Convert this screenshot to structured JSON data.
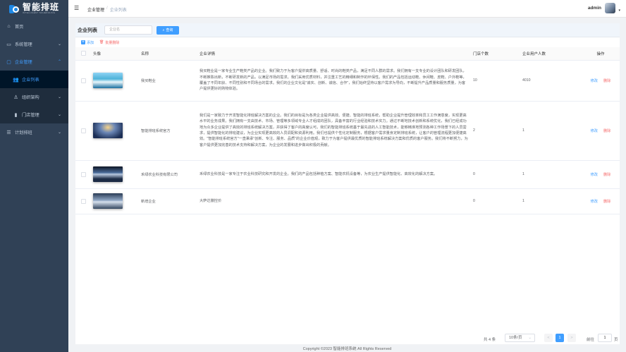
{
  "logo": {
    "title": "智能排班",
    "subtitle": "INTELLIGENT SCHEDULING"
  },
  "sidebar": {
    "items": [
      {
        "label": "首页",
        "icon": "home-icon"
      },
      {
        "label": "系统管理",
        "icon": "monitor-icon"
      },
      {
        "label": "企业管理",
        "icon": "chat-icon"
      },
      {
        "label": "企业列表",
        "icon": "users-icon"
      },
      {
        "label": "组织架构",
        "icon": "org-icon"
      },
      {
        "label": "门店管理",
        "icon": "store-icon"
      },
      {
        "label": "计划排班",
        "icon": "list-icon"
      }
    ]
  },
  "header": {
    "breadcrumb": [
      "企业管理",
      "企业列表"
    ],
    "separator": "/",
    "user": "admin"
  },
  "panel": {
    "title": "企业列表",
    "search_placeholder": "企业名",
    "search_button": "查询",
    "add_label": "添加",
    "batch_delete_label": "批量删除"
  },
  "table": {
    "headers": [
      "头像",
      "名称",
      "企业详情",
      "门店个数",
      "企业用户人数",
      "操作"
    ],
    "rows": [
      {
        "name": "我买鞋业",
        "detail": "我买鞋业是一家专业生产鞋类产品的企业。我们致力于为客户提供高质量、舒适、时尚的鞋类产品，满足不同人群的需求。我们拥有一支专业的设计团队和研发团队，不断推陈出新，不断研发新的产品，以满足市场的需求。我们采用优质材料，并注重工艺的精细和制作的环保性。我们的产品包括运动鞋、休闲鞋、皮鞋、户外鞋等，覆盖了不同年龄、不同性别和不同场合的需求。我们的企业文化是\"诚实、创新、诚信、合作\"，我们始终坚持以客户需求为导向，不断提升产品质量和服务质量，为客户提供更好的购物体验。",
        "stores": "10",
        "users": "4010",
        "edit": "修改",
        "delete": "删除"
      },
      {
        "name": "智能排班系统官方",
        "detail": "我们是一家致力于开发智能化排班解决方案的企业。我们的目标是为各类企业提供高效、便捷、智能的排班系统，帮助企业提升管理效率和员工工作满意度，实现更高水平的业务成果。我们拥有一支由技术、市场、管理等多领域专业人才组成的团队，具备丰富的行业经验和技术实力。通过不断地技术创新和系统优化，我们已经成功地为众多企业提供了高效的排班系统解决方案，并获得了客户的高度认可。我们的智能排班系统基于最先进的人工智能技术，能够精准地预测各种工作场景下的人员需求，提供智能化的排班建议，为企业实现更高效的人员调配和资源利用。我们也提供个性化定制服务，根据客户需求量身定制排班系统，让客户的管理流程更加便捷高效。\"智能排班系统官方\"一直秉承\"创新、专注、服务、品质\"的企业价值观，致力于为客户提供最优质的智能排班系统解决方案和优质的客户服务。我们将不断努力，为客户提供更加完善的技术支持和解决方案，为企业的发展和进步做出积极的贡献。",
        "stores": "2",
        "users": "1",
        "edit": "修改",
        "delete": "删除"
      },
      {
        "name": "禾绿农业科技有限公司",
        "detail": "禾绿农业科技是一家专注于农业科技研究和开发的企业。我们的产品包括种植方案、智能农机设备等，为农业生产提供智能化、高效化的解决方案。",
        "stores": "0",
        "users": "1",
        "edit": "修改",
        "delete": "删除"
      },
      {
        "name": "新增企业",
        "detail": "大萨达撒控价",
        "stores": "0",
        "users": "1",
        "edit": "修改",
        "delete": "删除"
      }
    ]
  },
  "pagination": {
    "total": "共 4 条",
    "page_size": "10条/页",
    "prev": "<",
    "current": "1",
    "next": ">",
    "goto": "前往",
    "jump_value": "1",
    "page_suffix": "页"
  },
  "footer": "Copyright ©2023 智能排班系统 All Rights Reserved",
  "colors": {
    "sidebar": "#304156",
    "accent": "#409eff",
    "danger": "#f56c6c"
  }
}
